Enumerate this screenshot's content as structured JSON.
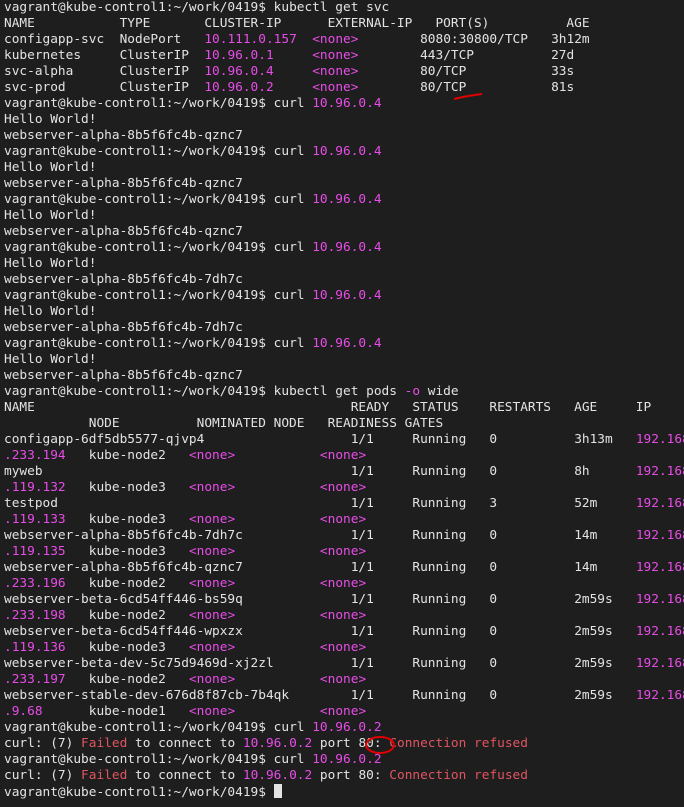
{
  "prompt": "vagrant@kube-control1:~/work/0419$ ",
  "svc": {
    "cmd": "kubectl get svc",
    "header": "NAME           TYPE       CLUSTER-IP      EXTERNAL-IP   PORT(S)          AGE",
    "rows": [
      {
        "name": "configapp-svc  ",
        "type": "NodePort   ",
        "ip": "10.111.0.157",
        "ip_pad": "  ",
        "ext": "<none>",
        "ext_pad": "        ",
        "port": "8080:30800/TCP",
        "port_pad": "   ",
        "age": "3h12m"
      },
      {
        "name": "kubernetes     ",
        "type": "ClusterIP  ",
        "ip": "10.96.0.1",
        "ip_pad": "     ",
        "ext": "<none>",
        "ext_pad": "        ",
        "port": "443/TCP",
        "port_pad": "          ",
        "age": "27d"
      },
      {
        "name": "svc-alpha      ",
        "type": "ClusterIP  ",
        "ip": "10.96.0.4",
        "ip_pad": "     ",
        "ext": "<none>",
        "ext_pad": "        ",
        "port": "80/TCP",
        "port_pad": "           ",
        "age": "33s"
      },
      {
        "name": "svc-prod       ",
        "type": "ClusterIP  ",
        "ip": "10.96.0.2",
        "ip_pad": "     ",
        "ext": "<none>",
        "ext_pad": "        ",
        "port": "80/TCP",
        "port_pad": "           ",
        "age": "81s"
      }
    ]
  },
  "curls": {
    "cmd": "curl ",
    "ip": "10.96.0.4",
    "hello": "Hello World!",
    "runs": [
      "webserver-alpha-8b5f6fc4b-qznc7",
      "webserver-alpha-8b5f6fc4b-qznc7",
      "webserver-alpha-8b5f6fc4b-qznc7",
      "webserver-alpha-8b5f6fc4b-7dh7c",
      "webserver-alpha-8b5f6fc4b-7dh7c",
      "webserver-alpha-8b5f6fc4b-qznc7"
    ]
  },
  "pods": {
    "cmd": "kubectl get pods ",
    "flag": "-o",
    "cmd_rest": " wide",
    "header1": "NAME                                         READY   STATUS    RESTARTS   AGE     IP",
    "header2": "           NODE          NOMINATED NODE   READINESS GATES",
    "rows": [
      {
        "name": "configapp-6df5db5577-qjvp4                   ",
        "ready": "1/1",
        "status": "Running",
        "restarts": "0",
        "age": "3h13m",
        "ip1": "192.168",
        "ip2": ".233.194",
        "node": "kube-node2"
      },
      {
        "name": "myweb                                        ",
        "ready": "1/1",
        "status": "Running",
        "restarts": "0",
        "age": "8h   ",
        "ip1": "192.168",
        "ip2": ".119.132",
        "node": "kube-node3"
      },
      {
        "name": "testpod                                      ",
        "ready": "1/1",
        "status": "Running",
        "restarts": "3",
        "age": "52m  ",
        "ip1": "192.168",
        "ip2": ".119.133",
        "node": "kube-node3"
      },
      {
        "name": "webserver-alpha-8b5f6fc4b-7dh7c              ",
        "ready": "1/1",
        "status": "Running",
        "restarts": "0",
        "age": "14m  ",
        "ip1": "192.168",
        "ip2": ".119.135",
        "node": "kube-node3"
      },
      {
        "name": "webserver-alpha-8b5f6fc4b-qznc7              ",
        "ready": "1/1",
        "status": "Running",
        "restarts": "0",
        "age": "14m  ",
        "ip1": "192.168",
        "ip2": ".233.196",
        "node": "kube-node2"
      },
      {
        "name": "webserver-beta-6cd54ff446-bs59q              ",
        "ready": "1/1",
        "status": "Running",
        "restarts": "0",
        "age": "2m59s",
        "ip1": "192.168",
        "ip2": ".233.198",
        "node": "kube-node2"
      },
      {
        "name": "webserver-beta-6cd54ff446-wpxzx              ",
        "ready": "1/1",
        "status": "Running",
        "restarts": "0",
        "age": "2m59s",
        "ip1": "192.168",
        "ip2": ".119.136",
        "node": "kube-node3"
      },
      {
        "name": "webserver-beta-dev-5c75d9469d-xj2zl          ",
        "ready": "1/1",
        "status": "Running",
        "restarts": "0",
        "age": "2m59s",
        "ip1": "192.168",
        "ip2": ".233.197",
        "node": "kube-node2"
      },
      {
        "name": "webserver-stable-dev-676d8f87cb-7b4qk        ",
        "ready": "1/1",
        "status": "Running",
        "restarts": "0",
        "age": "2m59s",
        "ip1": "192.168",
        "ip2": ".9.68",
        "node": "kube-node1"
      }
    ],
    "none": "<none>"
  },
  "fail": {
    "cmd": "curl ",
    "ip": "10.96.0.2",
    "prefix": "curl: (7) ",
    "failed": "Failed",
    "mid": " to connect to ",
    "port_word": " port ",
    "port": "80",
    "colon": ": ",
    "refused": "Connection refused"
  },
  "colors": {
    "background": "#1e1e1e",
    "text": "#e3e3e3",
    "ip_highlight": "#e84ce8",
    "error": "#e05561",
    "annotation": "#e00000"
  }
}
